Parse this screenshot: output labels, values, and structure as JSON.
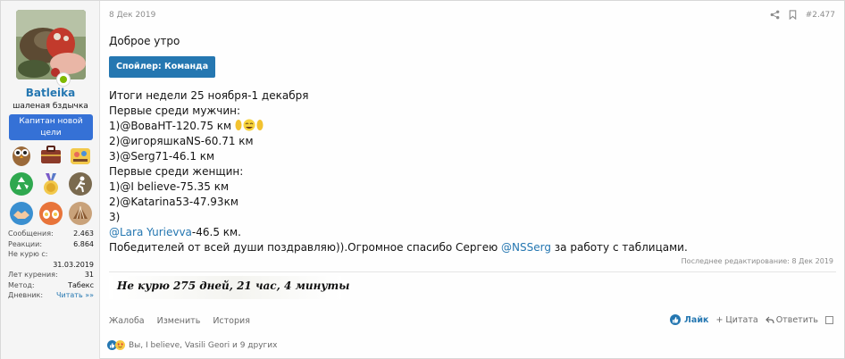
{
  "user": {
    "name": "Batleika",
    "title": "шаленая бздычка",
    "banner": "Капитан новой цели",
    "stats": [
      {
        "label": "Сообщения:",
        "value": "2.463"
      },
      {
        "label": "Реакции:",
        "value": "6.864"
      },
      {
        "label": "Не курю с:",
        "value": "31.03.2019"
      },
      {
        "label": "Лет курения:",
        "value": "31"
      },
      {
        "label": "Метод:",
        "value": "Табекс"
      },
      {
        "label": "Дневник:",
        "value": "Читать »»"
      }
    ]
  },
  "post": {
    "date": "8 Дек 2019",
    "number": "#2.477",
    "greeting": "Доброе утро",
    "spoiler_label": "Спойлер: Команда",
    "lines": {
      "l1": "Итоги недели 25 ноября-1 декабря",
      "l2": "Первые среди мужчин:",
      "l3": "1)@ВоваНТ-120.75 км",
      "l4": "2)@игоряшкаNS-60.71 км",
      "l5": "3)@Serg71-46.1 км",
      "l6": "Первые среди женщин:",
      "l7": "1)@I believe-75.35 км",
      "l8": "2)@Katarina53-47.93км",
      "l9": "3)",
      "l10_link": "@Lara Yurievva",
      "l10_rest": "-46.5 км.",
      "l11_pre": "Победителей от всей души поздравляю)).Огромное спасибо Сергею ",
      "l11_link": "@NSSerg",
      "l11_post": " за работу с таблицами."
    },
    "edited": "Последнее редактирование: 8 Дек 2019",
    "signature": "Не курю  275 дней, 21 час, 4 минуты"
  },
  "footer": {
    "report": "Жалоба",
    "edit": "Изменить",
    "history": "История",
    "like": "Лайк",
    "quote": "+ Цитата",
    "reply": "Ответить"
  },
  "reactions": {
    "text": "Вы, I believe, Vasili Geori и 9 других"
  },
  "colors": {
    "link": "#2577b1",
    "banner": "#3571d6",
    "online": "#7fb900",
    "spoiler": "#2577b1"
  }
}
